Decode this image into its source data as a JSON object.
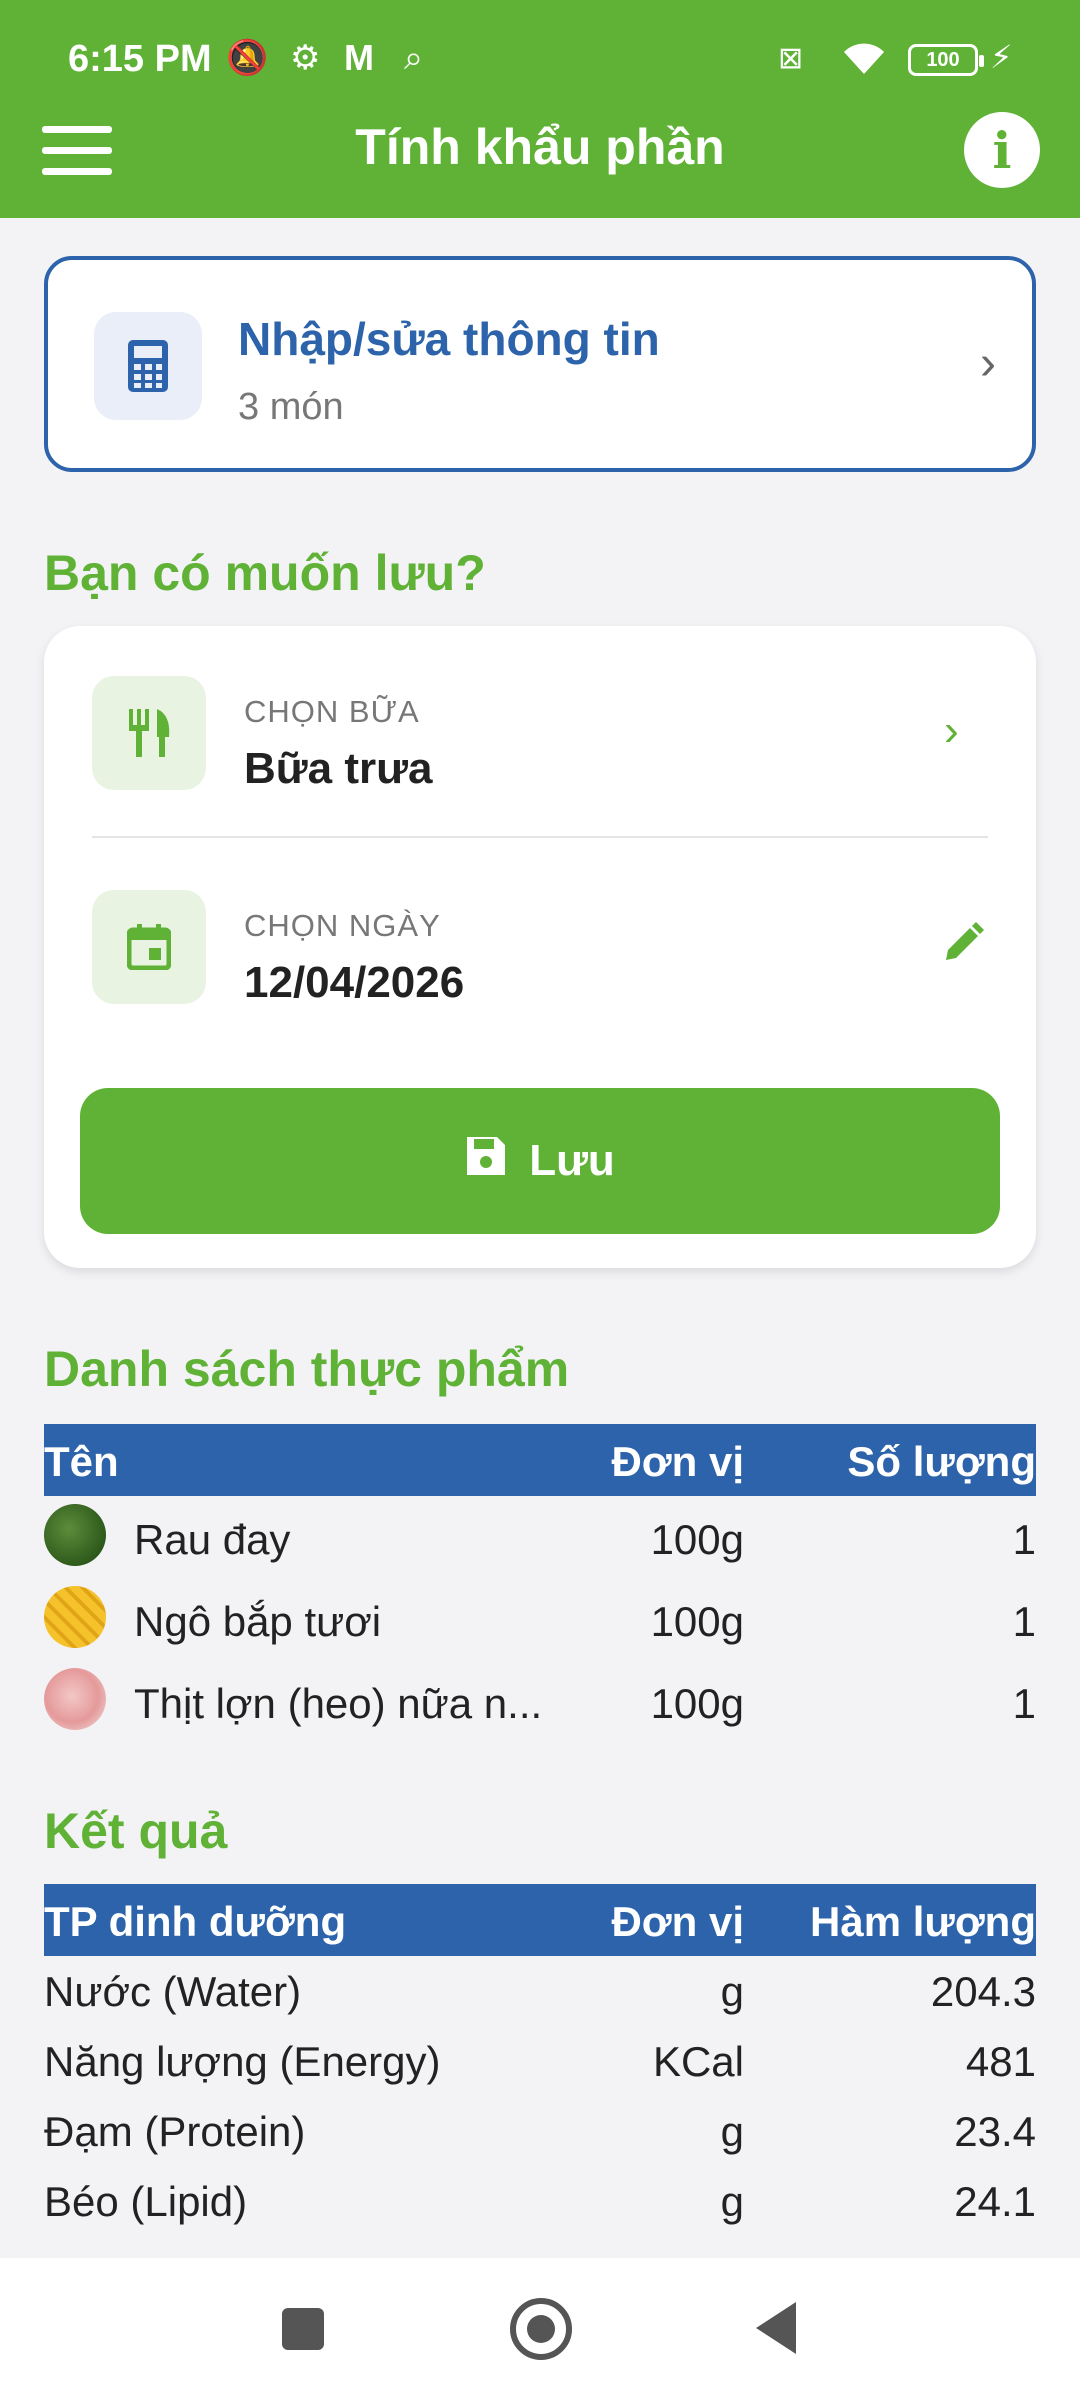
{
  "status_bar": {
    "time": "6:15 PM",
    "battery": "100",
    "icons": [
      "mute-icon",
      "settings-icon",
      "gmail-icon",
      "search-icon",
      "sim-off-icon",
      "wifi-icon",
      "battery-icon",
      "charging-icon"
    ]
  },
  "app_bar": {
    "title": "Tính khẩu phần",
    "menu_icon": "hamburger-menu-icon",
    "info_icon": "info-icon"
  },
  "edit_card": {
    "title": "Nhập/sửa thông tin",
    "subtitle": "3 món",
    "icon": "calculator-icon"
  },
  "save_section": {
    "title": "Bạn có muốn lưu?",
    "meal": {
      "label": "CHỌN BỮA",
      "value": "Bữa trưa",
      "icon": "fork-knife-icon"
    },
    "date": {
      "label": "CHỌN NGÀY",
      "value": "12/04/2026",
      "icon": "calendar-icon"
    },
    "save_button": "Lưu"
  },
  "food_list": {
    "title": "Danh sách thực phẩm",
    "headers": [
      "Tên",
      "Đơn vị",
      "Số lượng"
    ],
    "rows": [
      {
        "name": "Rau đay",
        "unit": "100g",
        "qty": "1"
      },
      {
        "name": "Ngô bắp tươi",
        "unit": "100g",
        "qty": "1"
      },
      {
        "name": "Thịt lợn (heo) nữa n...",
        "unit": "100g",
        "qty": "1"
      }
    ]
  },
  "results": {
    "title": "Kết quả",
    "headers": [
      "TP dinh dưỡng",
      "Đơn vị",
      "Hàm lượng"
    ],
    "rows": [
      {
        "name": "Nước (Water)",
        "unit": "g",
        "qty": "204.3"
      },
      {
        "name": "Năng lượng (Energy)",
        "unit": "KCal",
        "qty": "481"
      },
      {
        "name": "Đạm (Protein)",
        "unit": "g",
        "qty": "23.4"
      },
      {
        "name": "Béo (Lipid)",
        "unit": "g",
        "qty": "24.1"
      }
    ]
  },
  "colors": {
    "primary_green": "#5fb236",
    "header_blue": "#2c63aa"
  }
}
